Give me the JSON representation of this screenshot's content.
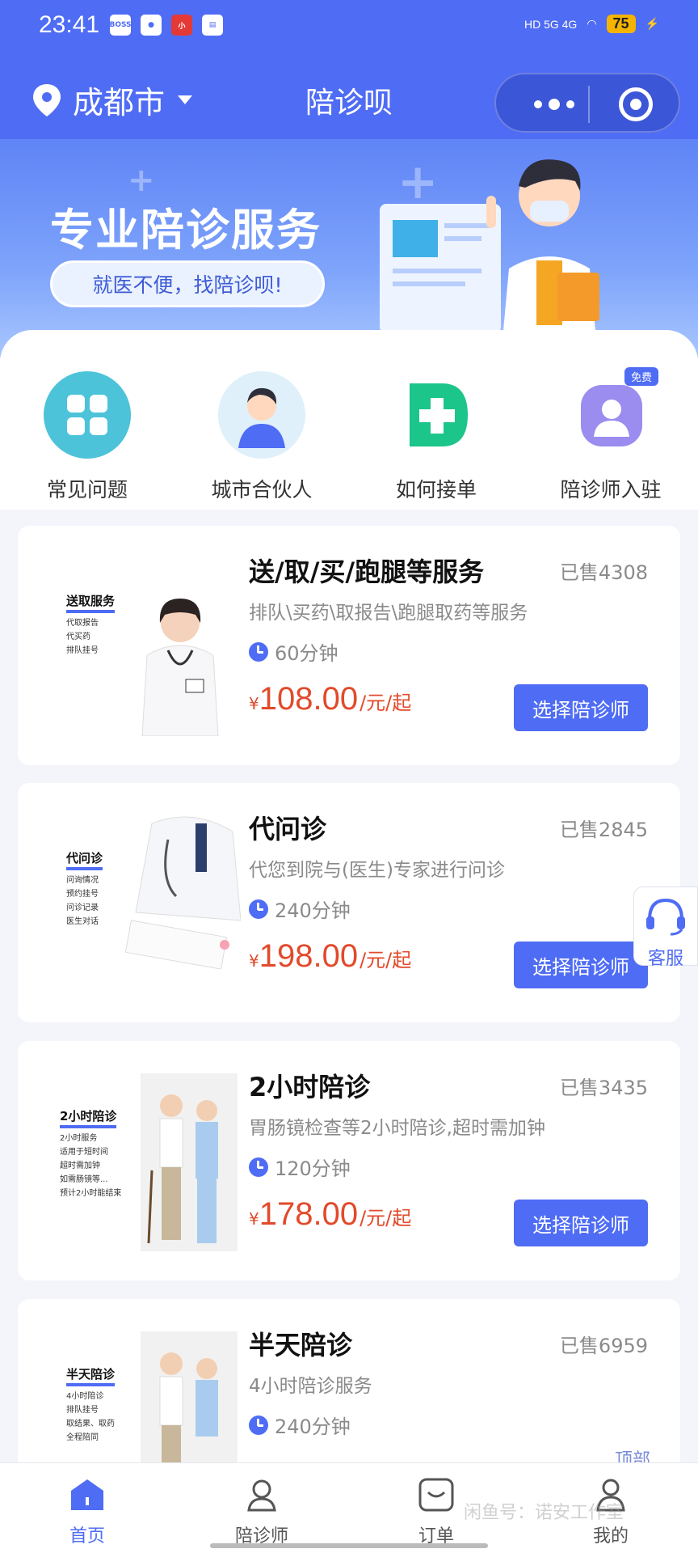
{
  "status_bar": {
    "time": "23:41",
    "app_icons": [
      "BOSS直聘",
      "消息",
      "小红书",
      "日历"
    ],
    "network": "HD 5G 4G",
    "battery": "75"
  },
  "header": {
    "city": "成都市",
    "title": "陪诊呗"
  },
  "banner": {
    "headline": "专业陪诊服务",
    "tagline": "就医不便，找陪诊呗!"
  },
  "quick_menu": [
    {
      "label": "常见问题",
      "icon": "grid-icon"
    },
    {
      "label": "城市合伙人",
      "icon": "partner-avatar-icon"
    },
    {
      "label": "如何接单",
      "icon": "plus-cross-icon"
    },
    {
      "label": "陪诊师入驻",
      "icon": "doctor-badge-icon",
      "badge": "免费"
    }
  ],
  "services": [
    {
      "title": "送/取/买/跑腿等服务",
      "sold": "已售4308",
      "desc": "排队\\买药\\取报告\\跑腿取药等服务",
      "duration": "60分钟",
      "currency": "¥",
      "price": "108.00",
      "unit": "/元/起",
      "button": "选择陪诊师",
      "thumb_title": "送取服务",
      "thumb_items": [
        "代取报告",
        "代买药",
        "排队挂号"
      ]
    },
    {
      "title": "代问诊",
      "sold": "已售2845",
      "desc": "代您到院与(医生)专家进行问诊",
      "duration": "240分钟",
      "currency": "¥",
      "price": "198.00",
      "unit": "/元/起",
      "button": "选择陪诊师",
      "thumb_title": "代问诊",
      "thumb_items": [
        "问询情况",
        "预约挂号",
        "问诊记录",
        "医生对话"
      ]
    },
    {
      "title": "2小时陪诊",
      "sold": "已售3435",
      "desc": "胃肠镜检查等2小时陪诊,超时需加钟",
      "duration": "120分钟",
      "currency": "¥",
      "price": "178.00",
      "unit": "/元/起",
      "button": "选择陪诊师",
      "thumb_title": "2小时陪诊",
      "thumb_items": [
        "2小时服务",
        "适用于短时间",
        "超时需加钟",
        "如需肠镜等...",
        "预计2小时能结束"
      ]
    },
    {
      "title": "半天陪诊",
      "sold": "已售6959",
      "desc": "4小时陪诊服务",
      "duration": "240分钟",
      "currency": "¥",
      "price": "",
      "unit": "",
      "button": "",
      "thumb_title": "半天陪诊",
      "thumb_items": [
        "4小时陪诊",
        "排队挂号",
        "取结果、取药",
        "全程陪同"
      ]
    }
  ],
  "floating": {
    "service_label": "客服",
    "top_label": "顶部"
  },
  "bottom_nav": [
    {
      "label": "首页",
      "icon": "home-icon",
      "active": true
    },
    {
      "label": "陪诊师",
      "icon": "person-icon",
      "active": false
    },
    {
      "label": "订单",
      "icon": "order-icon",
      "active": false
    },
    {
      "label": "我的",
      "icon": "profile-icon",
      "active": false
    }
  ],
  "watermark": "闲鱼号：诺安工作室",
  "colors": {
    "primary": "#4f6cf4",
    "price": "#e24a2b",
    "muted": "#8a8a8a"
  }
}
